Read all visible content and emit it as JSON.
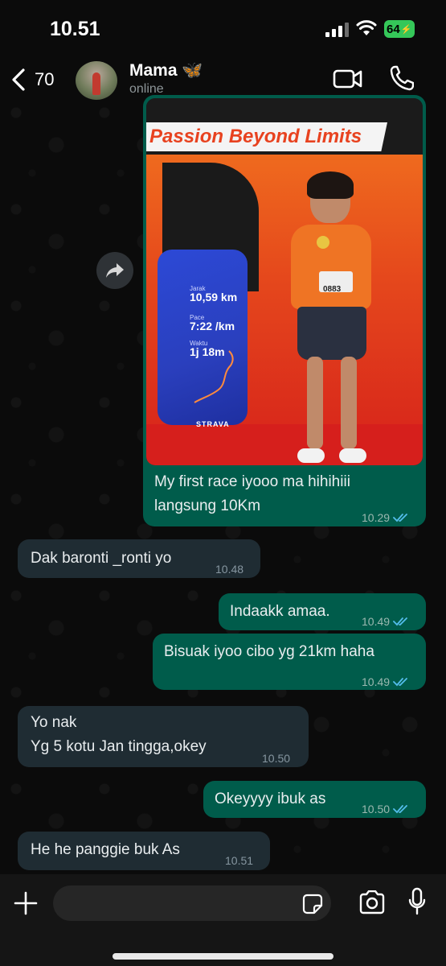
{
  "status_bar": {
    "time": "10.51",
    "battery": "64"
  },
  "header": {
    "back_count": "70",
    "contact_name": "Mama 🦋",
    "contact_status": "online"
  },
  "image_message": {
    "photo_tagline": "Passion Beyond Limits",
    "strava": {
      "distance_label": "Jarak",
      "distance": "10,59 km",
      "pace_label": "Pace",
      "pace": "7:22 /km",
      "time_label": "Waktu",
      "time": "1j 18m",
      "brand": "STRAVA"
    },
    "bib_number": "0883",
    "caption": "My first race iyooo ma hihihiii\nlangsung 10Km",
    "time": "10.29"
  },
  "messages": [
    {
      "direction": "in",
      "text": "Dak baronti _ronti yo",
      "time": "10.48"
    },
    {
      "direction": "out",
      "text": "Indaakk amaa.",
      "time": "10.49"
    },
    {
      "direction": "out",
      "text": "Bisuak iyoo cibo yg 21km haha",
      "time": "10.49"
    },
    {
      "direction": "in",
      "text": "Yo nak\nYg 5 kotu Jan  tingga,okey",
      "time": "10.50"
    },
    {
      "direction": "out",
      "text": "Okeyyyy ibuk as",
      "time": "10.50"
    },
    {
      "direction": "in",
      "text": "He he panggie buk As",
      "time": "10.51"
    }
  ],
  "colors": {
    "outgoing_bubble": "#005c4b",
    "incoming_bubble": "#1f2c33",
    "read_ticks": "#53bdeb",
    "background": "#0b0b0b"
  }
}
